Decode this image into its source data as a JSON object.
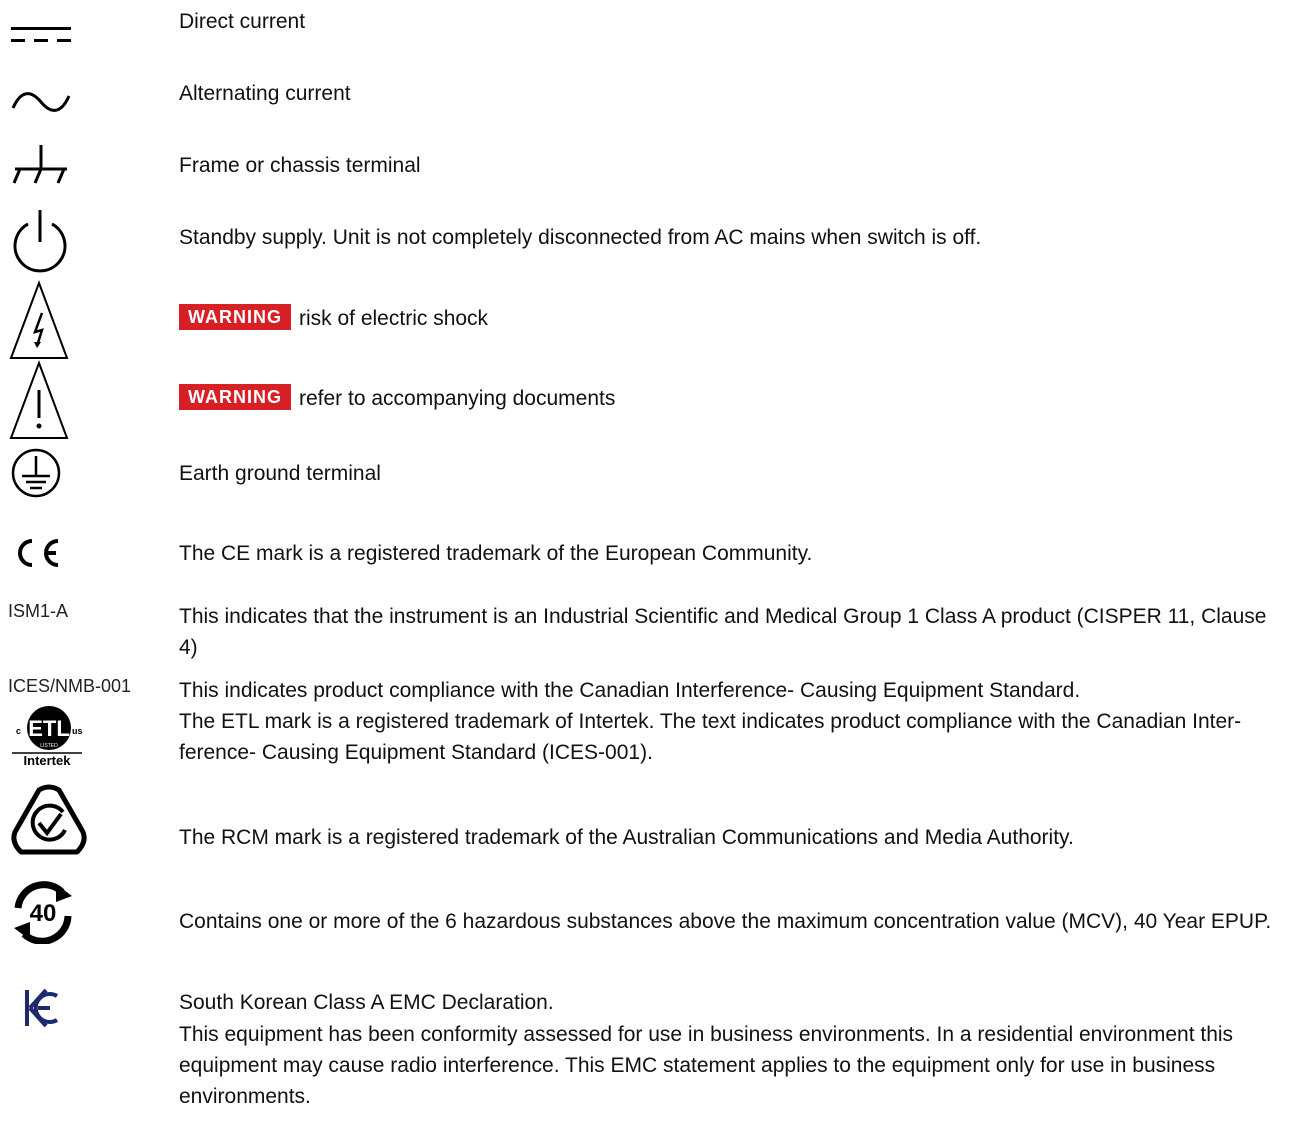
{
  "items": [
    {
      "symbol": "dc-icon",
      "text": "Direct current"
    },
    {
      "symbol": "ac-icon",
      "text": "Alternating current"
    },
    {
      "symbol": "chassis-icon",
      "text": "Frame or chassis terminal"
    },
    {
      "symbol": "standby-icon",
      "text": "Standby supply. Unit is not completely disconnected from AC mains when switch is off."
    },
    {
      "symbol": "shock-warning-icon",
      "badge": "WARNING",
      "text": "risk of electric shock"
    },
    {
      "symbol": "caution-icon",
      "badge": "WARNING",
      "text": "refer to accompanying documents"
    },
    {
      "symbol": "earth-ground-icon",
      "text": "Earth ground terminal"
    },
    {
      "symbol": "ce-mark-icon",
      "text": "The CE mark is a registered trademark of the European Community."
    },
    {
      "code": "ISM1-A",
      "text": "This indicates that the instrument is an Industrial Scientific and Medical Group 1 Class A product (CISPER 11, Clause 4)"
    },
    {
      "code": "ICES/NMB-001",
      "text": "This indicates product compliance with the Canadian Interference- Causing Equipment Standard."
    },
    {
      "symbol": "etl-mark-icon",
      "logo_text": [
        "c",
        "ETL",
        "LISTED",
        "us",
        "Intertek"
      ],
      "text": "The ETL mark is a registered trademark of Intertek. The text indicates product compliance with the Canadian Inter- ference- Causing Equipment Standard (ICES-001)."
    },
    {
      "symbol": "rcm-mark-icon",
      "text": "The RCM mark is a registered trademark of the Australian Communications and Media Authority."
    },
    {
      "symbol": "epup-40-icon",
      "logo_text": "40",
      "text": "Contains one or more of the 6 hazardous substances above the maximum concentration value (MCV), 40 Year EPUP."
    },
    {
      "symbol": "kc-mark-icon",
      "text": "South Korean Class A EMC Declaration.",
      "text2": "This equipment has been conformity assessed for use in business environments. In a residential environment this equipment may cause radio interference. This EMC statement applies to the equipment only for use in business environments."
    }
  ]
}
